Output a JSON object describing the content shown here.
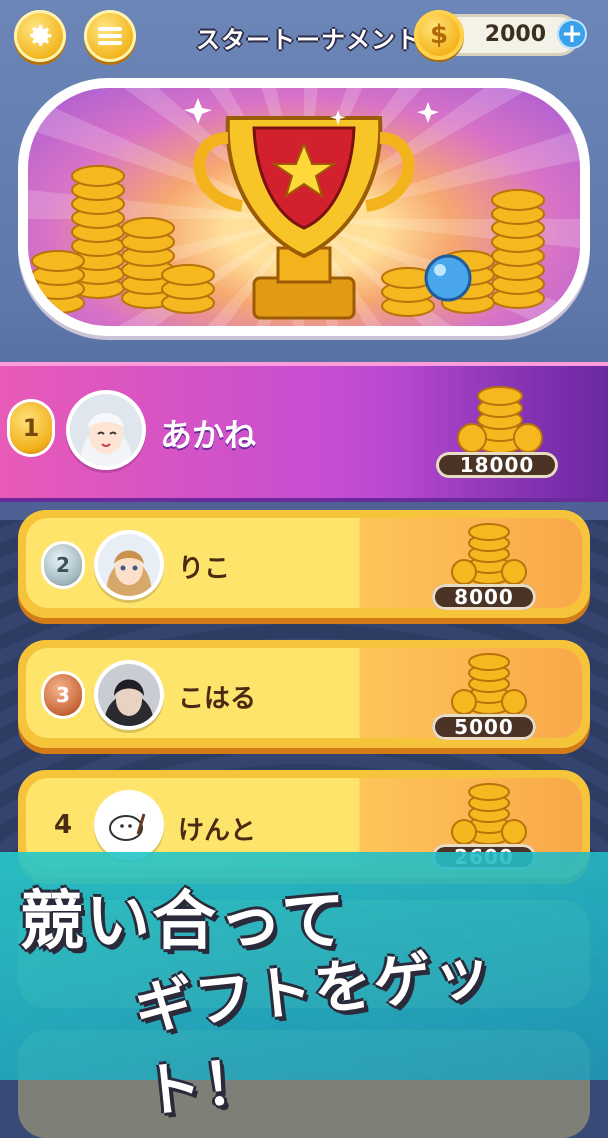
{
  "header": {
    "settings_icon": "gear-icon",
    "menu_icon": "menu-icon",
    "title": "スタートーナメント",
    "coin_balance": "2000",
    "coin_icon_glyph": "$",
    "add_coins_glyph": "+"
  },
  "banner": {
    "image": "trophy-with-coins"
  },
  "leaderboard": [
    {
      "rank": "1",
      "name": "あかね",
      "score": "18000",
      "medal": "gold"
    },
    {
      "rank": "2",
      "name": "りこ",
      "score": "8000",
      "medal": "silver"
    },
    {
      "rank": "3",
      "name": "こはる",
      "score": "5000",
      "medal": "bronze"
    },
    {
      "rank": "4",
      "name": "けんと",
      "score": "2600",
      "medal": ""
    }
  ],
  "promo": {
    "line1": "競い合って",
    "line2": "ギフトをゲット！"
  },
  "colors": {
    "accent_pink": "#e85ab7",
    "accent_purple": "#8b39c4",
    "row_yellow": "#ffe46b",
    "overlay_teal": "#28c8c8"
  }
}
